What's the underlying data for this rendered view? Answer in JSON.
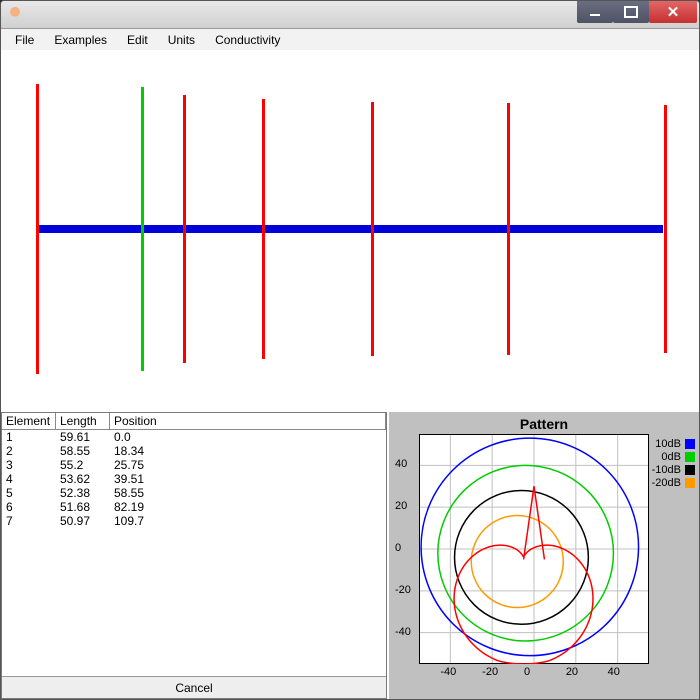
{
  "window_title": "",
  "menubar": [
    "File",
    "Examples",
    "Edit",
    "Units",
    "Conductivity"
  ],
  "elements": [
    {
      "n": "1",
      "length": "59.61",
      "position": "0.0"
    },
    {
      "n": "2",
      "length": "58.55",
      "position": "18.34"
    },
    {
      "n": "3",
      "length": "55.2",
      "position": "25.75"
    },
    {
      "n": "4",
      "length": "53.62",
      "position": "39.51"
    },
    {
      "n": "5",
      "length": "52.38",
      "position": "58.55"
    },
    {
      "n": "6",
      "length": "51.68",
      "position": "82.19"
    },
    {
      "n": "7",
      "length": "50.97",
      "position": "109.7"
    }
  ],
  "table_headers": [
    "Element",
    "Length",
    "Position"
  ],
  "cancel_label": "Cancel",
  "pattern_title": "Pattern",
  "legend": [
    {
      "label": "10dB",
      "color": "#0000ff"
    },
    {
      "label": "0dB",
      "color": "#00cc00"
    },
    {
      "label": "-10dB",
      "color": "#000000"
    },
    {
      "label": "-20dB",
      "color": "#ff9900"
    }
  ],
  "chart_data": {
    "type": "polar",
    "title": "Pattern",
    "x_ticks": [
      -40,
      -20,
      0,
      20,
      40
    ],
    "y_ticks": [
      -40,
      -20,
      0,
      20,
      40
    ],
    "xlim": [
      -55,
      55
    ],
    "ylim": [
      -55,
      55
    ],
    "rings": [
      {
        "label": "10dB",
        "radius": 52,
        "center": [
          -2,
          1
        ],
        "color": "#0000ff"
      },
      {
        "label": "0dB",
        "radius": 42,
        "center": [
          -4,
          -2
        ],
        "color": "#00cc00"
      },
      {
        "label": "-10dB",
        "radius": 32,
        "center": [
          -6,
          -4
        ],
        "color": "#000000"
      },
      {
        "label": "-20dB",
        "radius": 22,
        "center": [
          -8,
          -6
        ],
        "color": "#ff9900"
      }
    ],
    "pattern_curve": {
      "color": "#ff0000",
      "note": "directional antenna radiation lobe, cardioid-like, null at top center, axes x=[-55,55] y=[-55,55]"
    }
  }
}
